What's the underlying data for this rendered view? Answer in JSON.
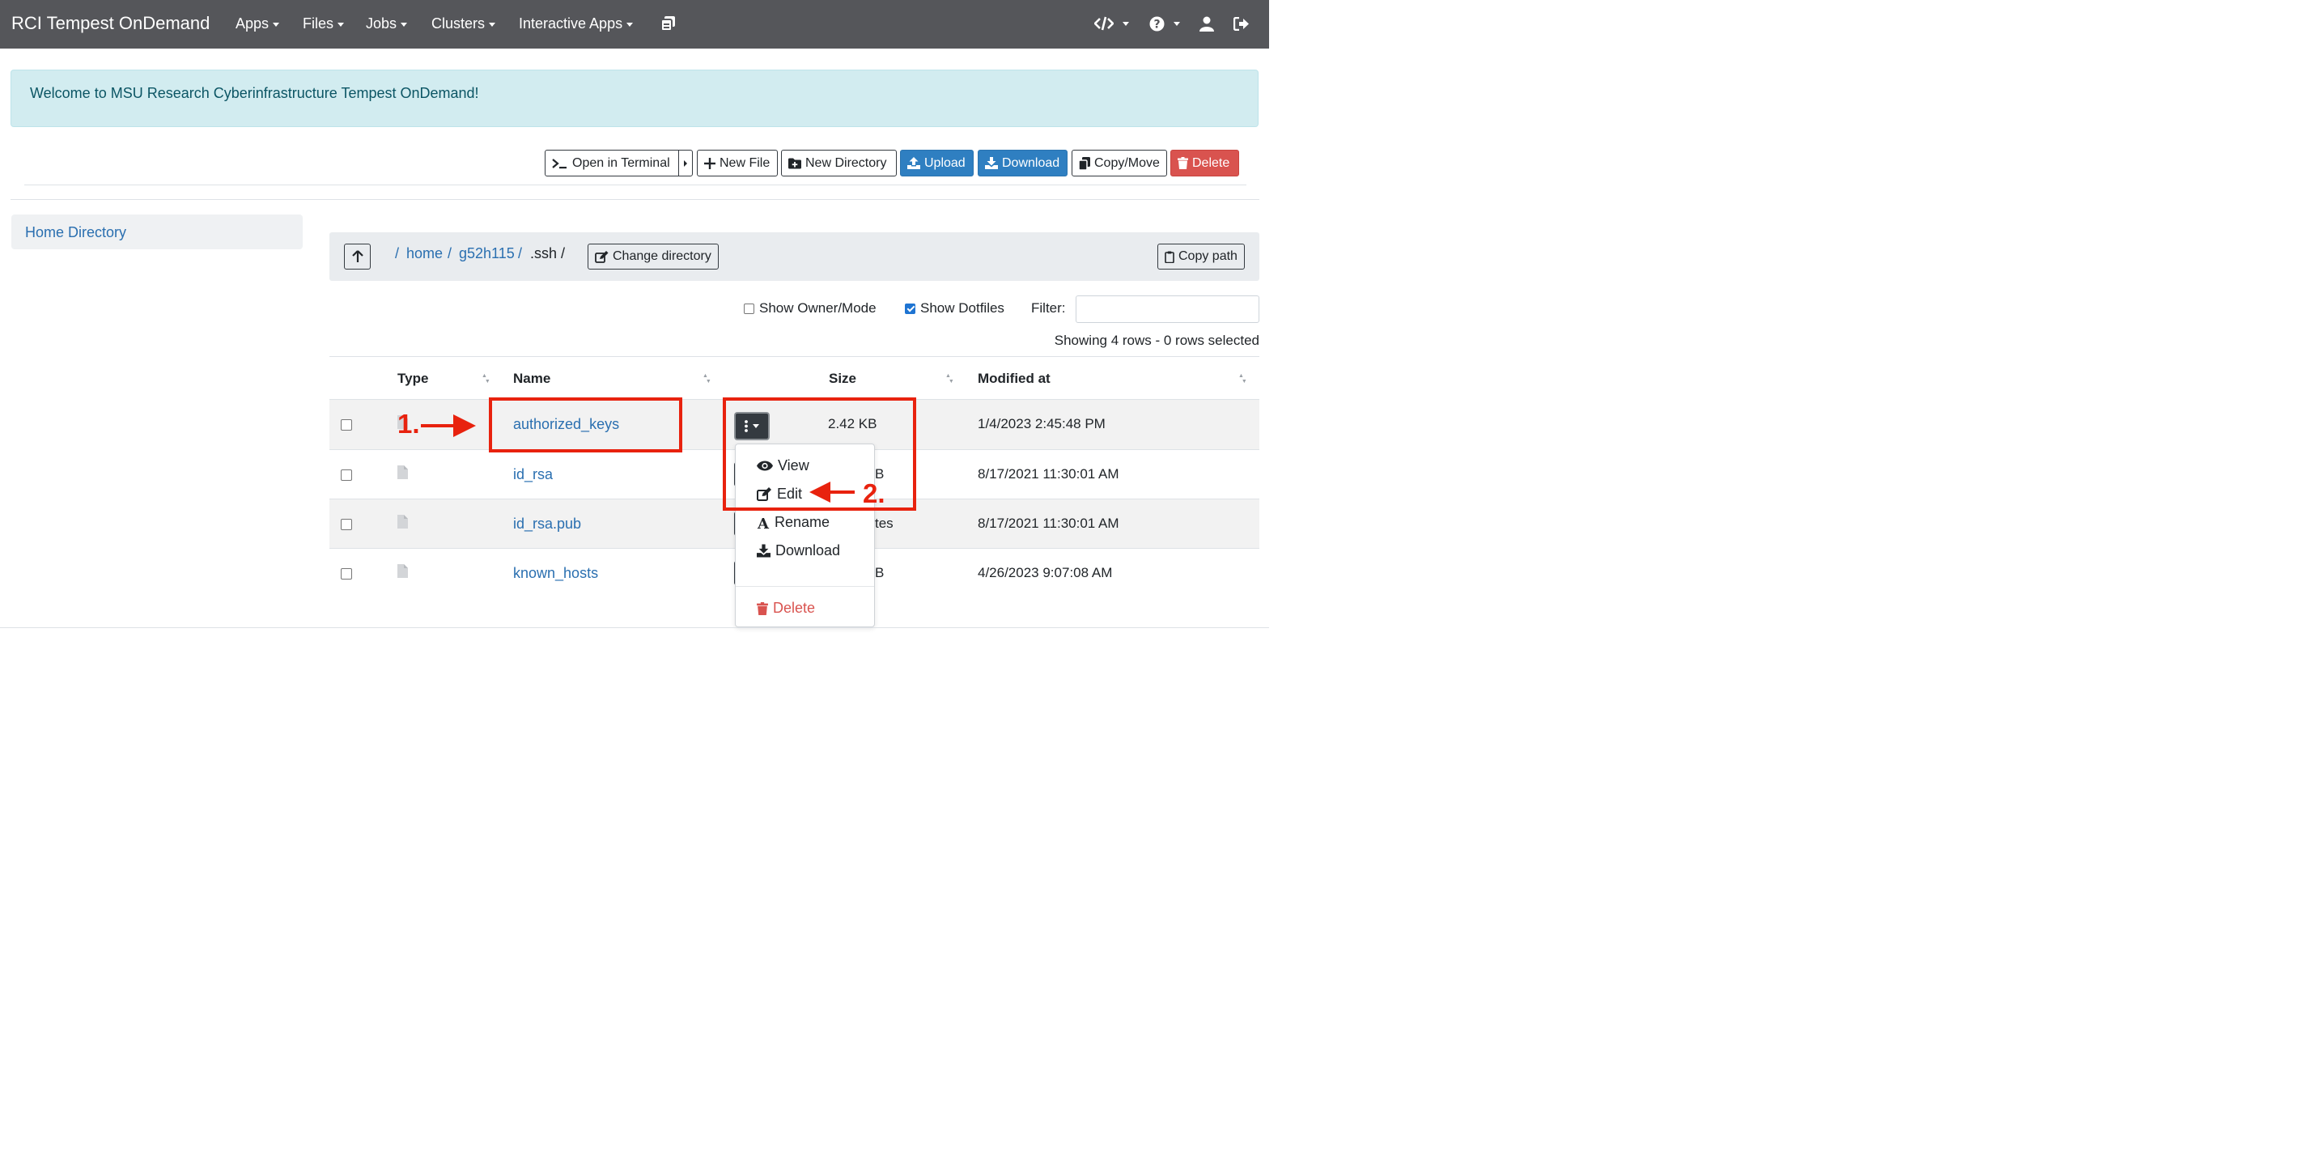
{
  "navbar": {
    "brand": "RCI Tempest OnDemand",
    "menus": [
      "Apps",
      "Files",
      "Jobs",
      "Clusters",
      "Interactive Apps"
    ],
    "icons": [
      "dashboard-windows-icon",
      "code-icon",
      "help-icon",
      "user-icon",
      "logout-icon"
    ]
  },
  "alert": {
    "text": "Welcome to MSU Research Cyberinfrastructure Tempest OnDemand!"
  },
  "toolbar": {
    "open_terminal": "Open in Terminal",
    "new_file": "New File",
    "new_directory": "New Directory",
    "upload": "Upload",
    "download": "Download",
    "copy_move": "Copy/Move",
    "delete": "Delete"
  },
  "sidebar": {
    "home_directory": "Home Directory"
  },
  "breadcrumb": {
    "segments": [
      "home",
      "g52h115",
      ".ssh"
    ],
    "change_directory": "Change directory",
    "copy_path": "Copy path"
  },
  "options": {
    "show_owner_mode": "Show Owner/Mode",
    "show_owner_mode_checked": false,
    "show_dotfiles": "Show Dotfiles",
    "show_dotfiles_checked": true,
    "filter_label": "Filter:",
    "filter_value": ""
  },
  "status": {
    "showing": "Showing 4 rows - 0 rows selected"
  },
  "table": {
    "columns": [
      "Type",
      "Name",
      "Size",
      "Modified at"
    ],
    "rows": [
      {
        "name": "authorized_keys",
        "size": "2.42 KB",
        "modified": "1/4/2023 2:45:48 PM"
      },
      {
        "name": "id_rsa",
        "size": "B",
        "modified": "8/17/2021 11:30:01 AM"
      },
      {
        "name": "id_rsa.pub",
        "size": "tes",
        "modified": "8/17/2021 11:30:01 AM"
      },
      {
        "name": "known_hosts",
        "size": "B",
        "modified": "4/26/2023 9:07:08 AM"
      }
    ]
  },
  "dropdown": {
    "items": [
      "View",
      "Edit",
      "Rename",
      "Download",
      "Delete"
    ]
  },
  "annotations": {
    "step1": "1.",
    "step2": "2."
  },
  "colors": {
    "navbar": "#55565a",
    "alert_bg": "#d2ecf0",
    "primary": "#2f7fc1",
    "danger": "#d9534f",
    "link": "#2a6fb0",
    "annotation": "#e8220e"
  }
}
